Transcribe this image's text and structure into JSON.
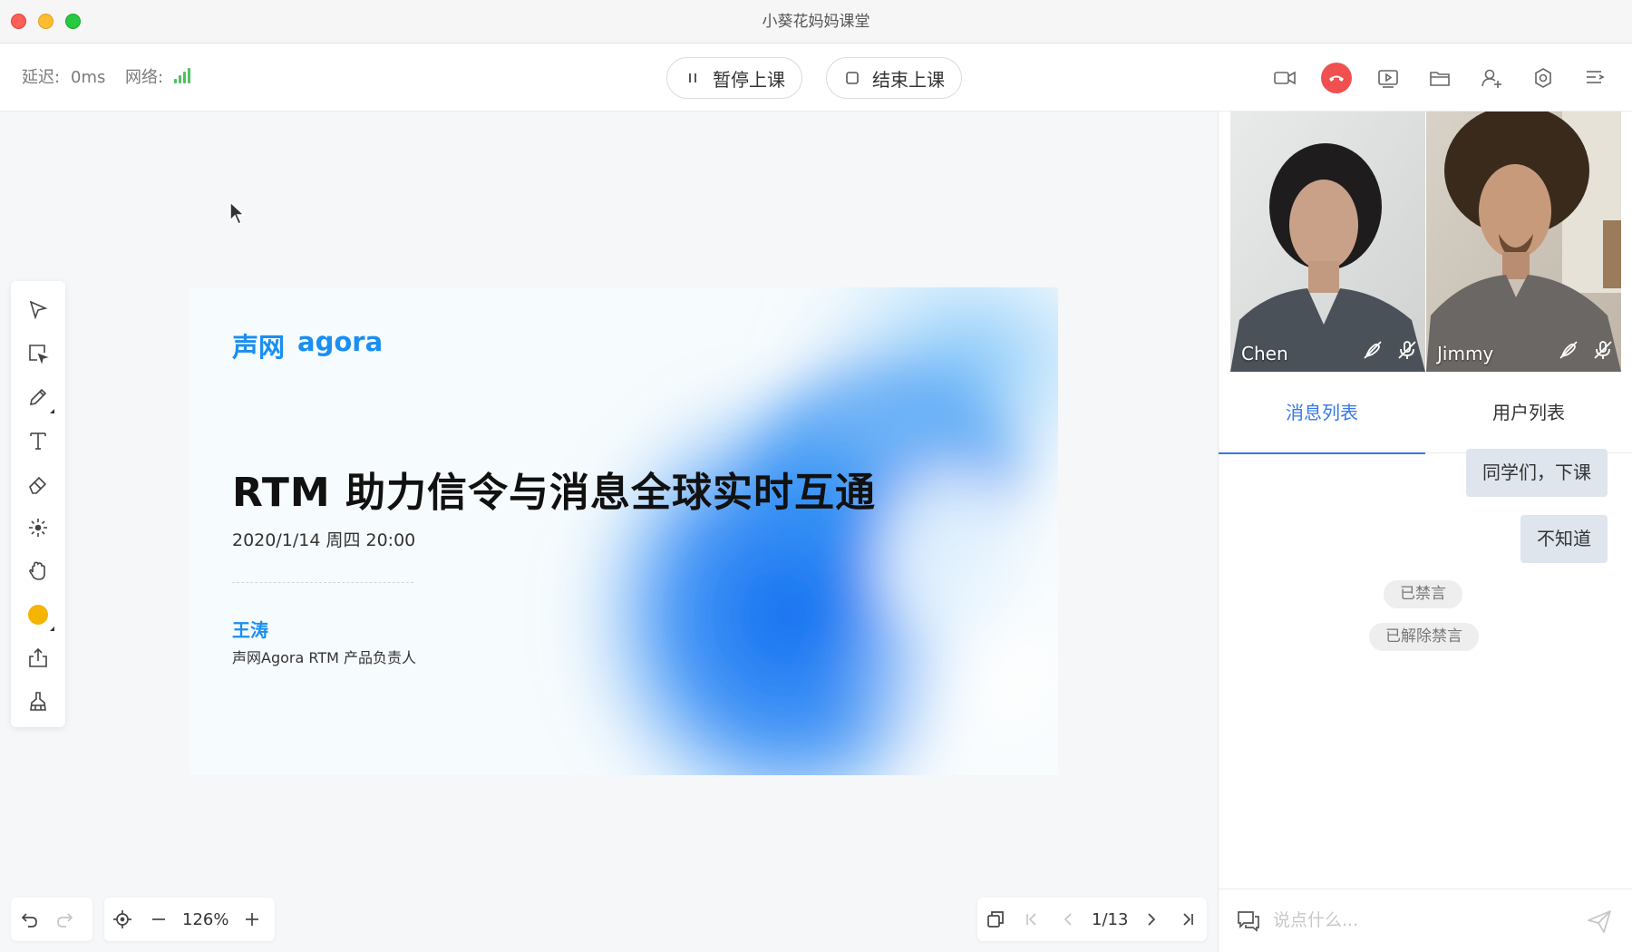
{
  "window": {
    "title": "小葵花妈妈课堂"
  },
  "toolbar": {
    "latency_label": "延迟:",
    "latency_value": "0ms",
    "network_label": "网络:",
    "pause_label": "暂停上课",
    "end_label": "结束上课",
    "icons": [
      "camera-icon",
      "hangup-icon",
      "media-icon",
      "folder-icon",
      "add-user-icon",
      "settings-icon",
      "menu-icon"
    ]
  },
  "tools": [
    "select-icon",
    "selector-icon",
    "pencil-icon",
    "text-icon",
    "eraser-icon",
    "laser-icon",
    "hand-icon",
    "color-icon",
    "upload-icon",
    "clear-icon"
  ],
  "slide": {
    "logo_cn": "声网",
    "logo_en": "agora",
    "title": "RTM 助力信令与消息全球实时互通",
    "date": "2020/1/14 周四 20:00",
    "speaker": "王涛",
    "role": "声网Agora RTM 产品负责人"
  },
  "zoom": {
    "value": "126%"
  },
  "pager": {
    "value": "1/13"
  },
  "videos": [
    {
      "name": "Chen"
    },
    {
      "name": "Jimmy"
    }
  ],
  "tabs": {
    "messages": "消息列表",
    "users": "用户列表"
  },
  "messages": [
    {
      "text": "同学们，下课"
    },
    {
      "text": "不知道"
    }
  ],
  "system_notices": [
    "已禁言",
    "已解除禁言"
  ],
  "chat": {
    "placeholder": "说点什么..."
  },
  "colors": {
    "accent": "#3479e8",
    "hangup": "#f05050",
    "signal": "#4fc25f",
    "pen_color": "#f4b400"
  }
}
